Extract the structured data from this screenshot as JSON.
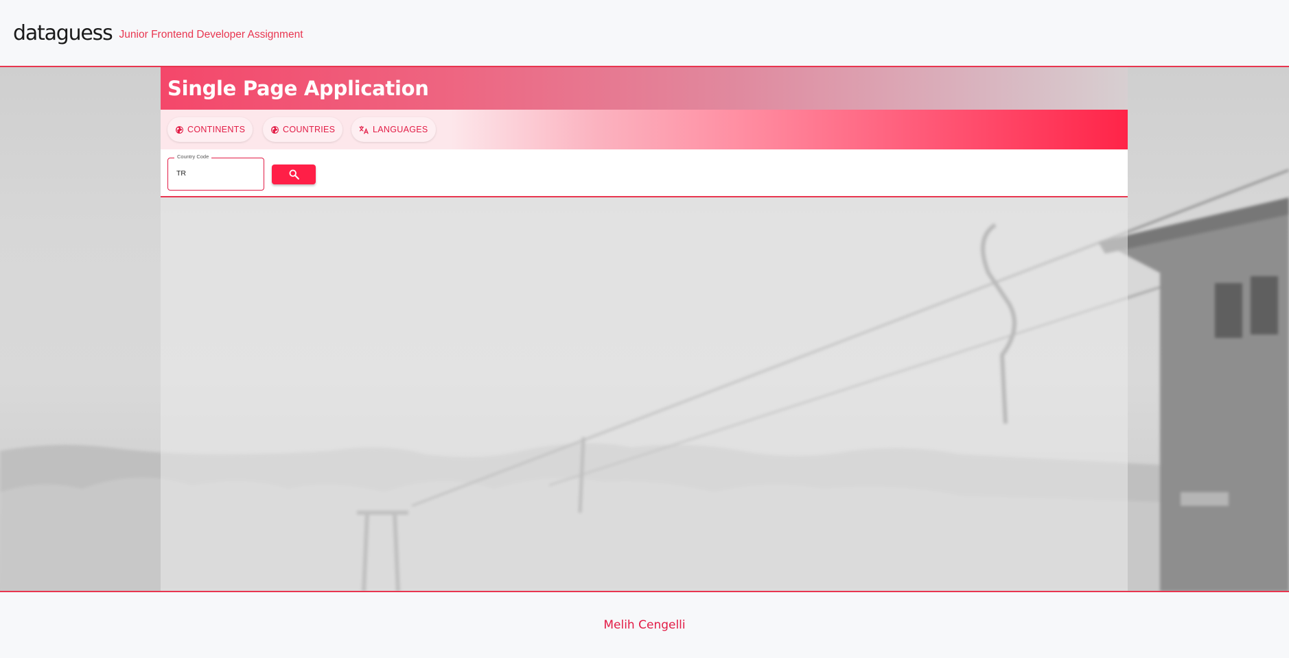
{
  "header": {
    "brand": "dataguess",
    "tagline": "Junior Frontend Developer Assignment"
  },
  "app": {
    "title": "Single Page Application",
    "tabs": [
      {
        "label": "CONTINENTS",
        "icon": "globe-icon"
      },
      {
        "label": "COUNTRIES",
        "icon": "globe-icon"
      },
      {
        "label": "LANGUAGES",
        "icon": "translate-icon"
      }
    ],
    "search": {
      "label": "Country Code",
      "value": "TR",
      "button_icon": "search-icon"
    }
  },
  "footer": {
    "author": "Melih Cengelli"
  },
  "colors": {
    "accent": "#e21b45",
    "button": "#ff1f47",
    "border": "#e8354f"
  }
}
